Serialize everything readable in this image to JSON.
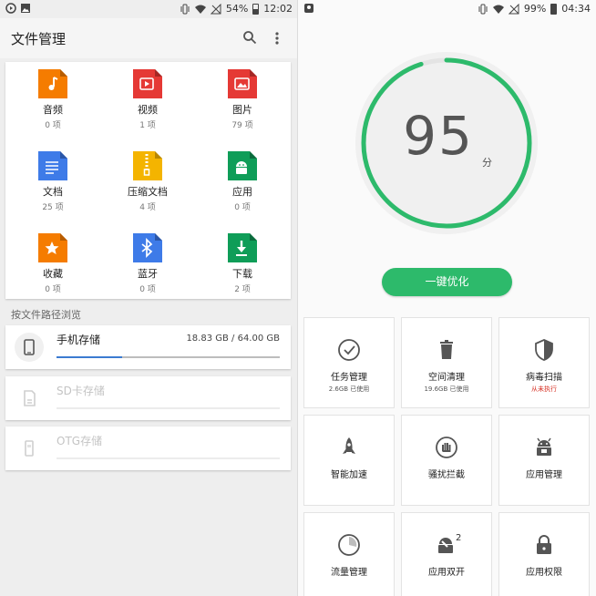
{
  "left": {
    "status": {
      "battery": "54%",
      "time": "12:02"
    },
    "title": "文件管理",
    "categories": [
      {
        "label": "音频",
        "count": "0 项",
        "color": "#f57c00",
        "icon": "music-icon"
      },
      {
        "label": "视频",
        "count": "1 项",
        "color": "#e53935",
        "icon": "video-icon"
      },
      {
        "label": "图片",
        "count": "79 项",
        "color": "#e53935",
        "icon": "image-icon"
      },
      {
        "label": "文档",
        "count": "25 项",
        "color": "#3e7be8",
        "icon": "document-icon"
      },
      {
        "label": "压缩文档",
        "count": "4 项",
        "color": "#f4b400",
        "icon": "zip-icon"
      },
      {
        "label": "应用",
        "count": "0 项",
        "color": "#0f9d58",
        "icon": "android-icon"
      },
      {
        "label": "收藏",
        "count": "0 项",
        "color": "#f57c00",
        "icon": "star-icon"
      },
      {
        "label": "蓝牙",
        "count": "0 项",
        "color": "#3e7be8",
        "icon": "bluetooth-icon"
      },
      {
        "label": "下载",
        "count": "2 项",
        "color": "#0f9d58",
        "icon": "download-icon"
      }
    ],
    "browse_label": "按文件路径浏览",
    "storage": [
      {
        "name": "手机存储",
        "size": "18.83 GB / 64.00 GB",
        "used_fraction": 0.294
      },
      {
        "name": "SD卡存储"
      },
      {
        "name": "OTG存储"
      }
    ]
  },
  "right": {
    "status": {
      "battery": "99%",
      "time": "04:34"
    },
    "score": "95",
    "score_unit": "分",
    "score_fraction": 0.95,
    "optimize_label": "一键优化",
    "accent": "#2dba6b",
    "tiles": [
      {
        "label": "任务管理",
        "sub": "2.6GB 已使用",
        "icon": "check-circle-icon"
      },
      {
        "label": "空间清理",
        "sub": "19.6GB 已使用",
        "icon": "trash-icon"
      },
      {
        "label": "病毒扫描",
        "sub": "从未执行",
        "icon": "shield-icon",
        "warn": true
      },
      {
        "label": "智能加速",
        "icon": "rocket-icon"
      },
      {
        "label": "骚扰拦截",
        "icon": "hand-block-icon"
      },
      {
        "label": "应用管理",
        "icon": "app-manage-icon"
      },
      {
        "label": "流量管理",
        "icon": "data-usage-icon"
      },
      {
        "label": "应用双开",
        "icon": "dual-app-icon",
        "badge": "2"
      },
      {
        "label": "应用权限",
        "icon": "lock-icon"
      }
    ]
  }
}
